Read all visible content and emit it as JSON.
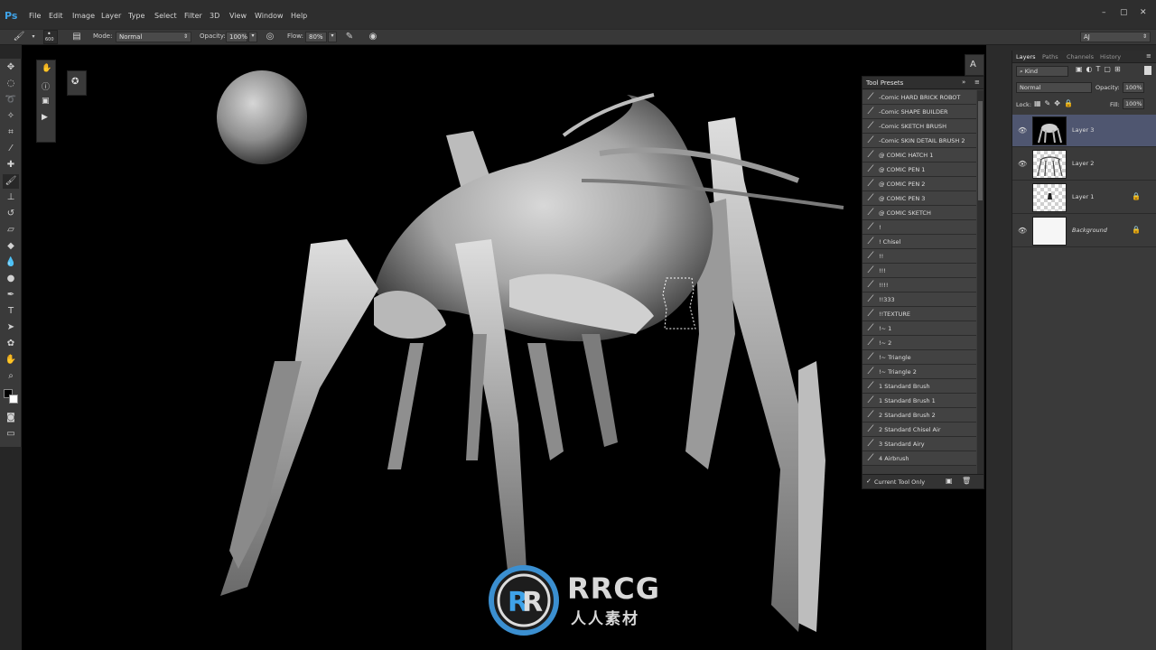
{
  "app": {
    "logo": "Ps"
  },
  "menu": [
    "File",
    "Edit",
    "Image",
    "Layer",
    "Type",
    "Select",
    "Filter",
    "3D",
    "View",
    "Window",
    "Help"
  ],
  "options": {
    "brush_size": "600",
    "mode_label": "Mode:",
    "mode_value": "Normal",
    "opacity_label": "Opacity:",
    "opacity_value": "100%",
    "flow_label": "Flow:",
    "flow_value": "80%",
    "workspace": "AJ"
  },
  "tool_presets": {
    "title": "Tool Presets",
    "items": [
      "-Comic HARD BRICK ROBOT",
      "-Comic SHAPE BUILDER",
      "-Comic SKETCH BRUSH",
      "-Comic SKIN DETAIL BRUSH 2",
      "@ COMIC HATCH 1",
      "@ COMIC PEN 1",
      "@ COMIC PEN 2",
      "@ COMIC PEN 3",
      "@ COMIC SKETCH",
      "!",
      "! Chisel",
      "!!",
      "!!!",
      "!!!!",
      "!!333",
      "!!TEXTURE",
      "!~ 1",
      "!~ 2",
      "!~ Triangle",
      "!~ Triangle 2",
      "1 Standard Brush",
      "1 Standard Brush 1",
      "2 Standard Brush 2",
      "2 Standard Chisel Air",
      "3 Standard Airy",
      "4 Airbrush"
    ],
    "footer_checkbox": "Current Tool Only"
  },
  "layers_panel": {
    "tabs": [
      "Layers",
      "Paths",
      "Channels",
      "History"
    ],
    "filter": "Kind",
    "blend_mode": "Normal",
    "opacity_label": "Opacity:",
    "opacity_value": "100%",
    "lock_label": "Lock:",
    "fill_label": "Fill:",
    "fill_value": "100%",
    "layers": [
      {
        "name": "Layer 3",
        "visible": true,
        "selected": true
      },
      {
        "name": "Layer 2",
        "visible": true,
        "selected": false
      },
      {
        "name": "Layer 1",
        "visible": false,
        "selected": false
      },
      {
        "name": "Background",
        "visible": true,
        "selected": false
      }
    ]
  },
  "watermark": {
    "title": "RRCG",
    "subtitle": "人人素材"
  },
  "colors": {
    "accent": "#3fa3e8",
    "selected_layer": "#4f5670",
    "canvas": "#000000"
  }
}
